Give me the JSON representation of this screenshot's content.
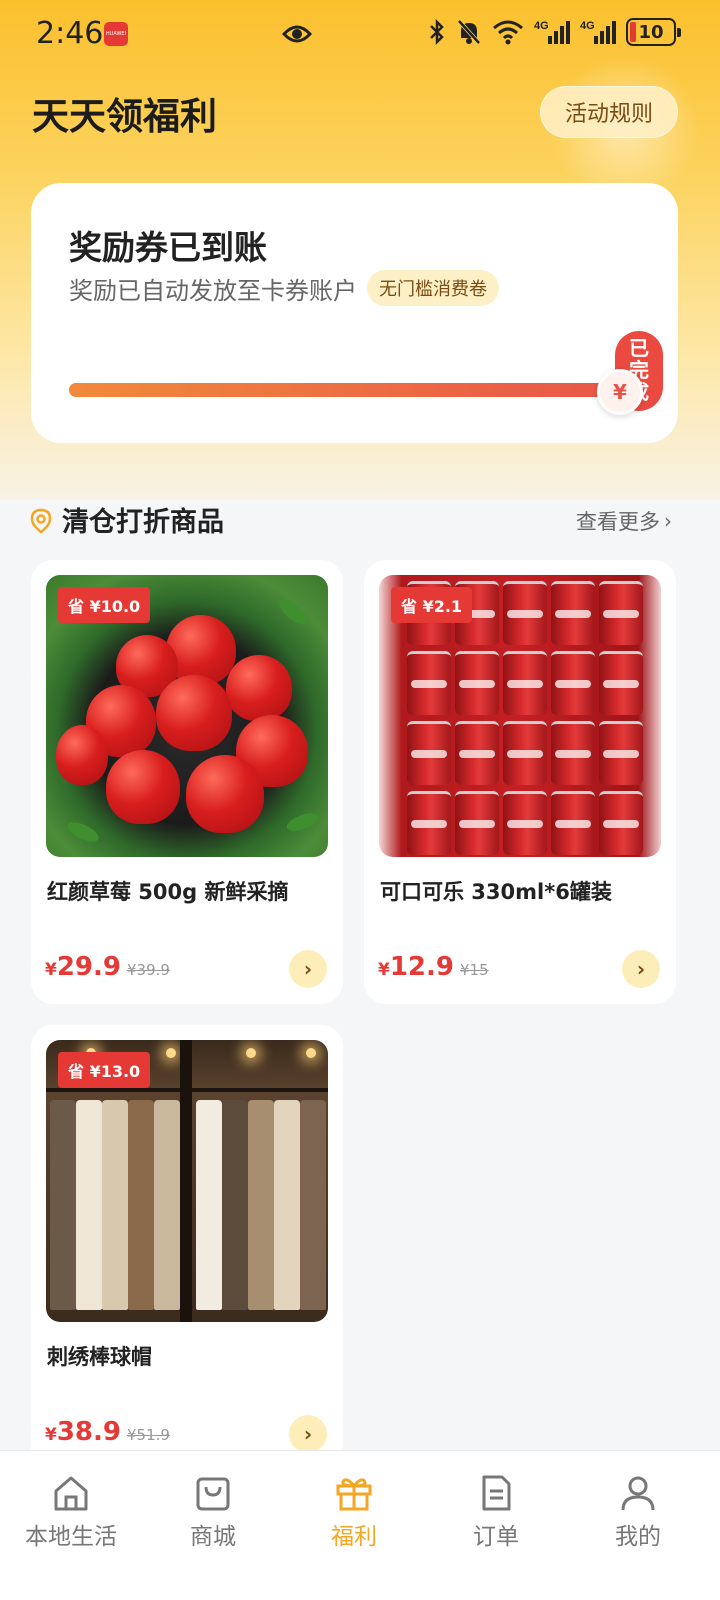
{
  "status_bar": {
    "time": "2:46",
    "notification_app": "HUAWEI",
    "network_1": "4G",
    "network_2": "4G",
    "battery": "10"
  },
  "header": {
    "title": "天天领福利",
    "rules_button": "活动规则"
  },
  "reward_card": {
    "title": "奖励券已到账",
    "description": "奖励已自动发放至卡券账户",
    "tag": "无门槛消费卷",
    "progress": 1.0,
    "done_badge": "已完成",
    "coin_symbol": "¥"
  },
  "section": {
    "title": "清仓打折商品",
    "more_link": "查看更多"
  },
  "products": [
    {
      "name": "红颜草莓 500g 新鲜采摘",
      "save_badge": "省 ¥10.0",
      "currency": "¥",
      "price": "29.9",
      "original_price": "¥39.9",
      "image": "strawberries"
    },
    {
      "name": "可口可乐 330ml*6罐装",
      "save_badge": "省 ¥2.1",
      "currency": "¥",
      "price": "12.9",
      "original_price": "¥15",
      "image": "coca-cola-cans"
    },
    {
      "name": "刺绣棒球帽",
      "save_badge": "省 ¥13.0",
      "currency": "¥",
      "price": "38.9",
      "original_price": "¥51.9",
      "image": "clothing-rack"
    }
  ],
  "tabbar": [
    {
      "label": "本地生活",
      "icon": "home-icon",
      "active": false
    },
    {
      "label": "商城",
      "icon": "shopping-bag-icon",
      "active": false
    },
    {
      "label": "福利",
      "icon": "gift-icon",
      "active": true
    },
    {
      "label": "订单",
      "icon": "document-icon",
      "active": false
    },
    {
      "label": "我的",
      "icon": "user-icon",
      "active": false
    }
  ],
  "colors": {
    "brand_yellow": "#fbc02d",
    "accent_red": "#e53935",
    "active_tab": "#f5a623"
  }
}
